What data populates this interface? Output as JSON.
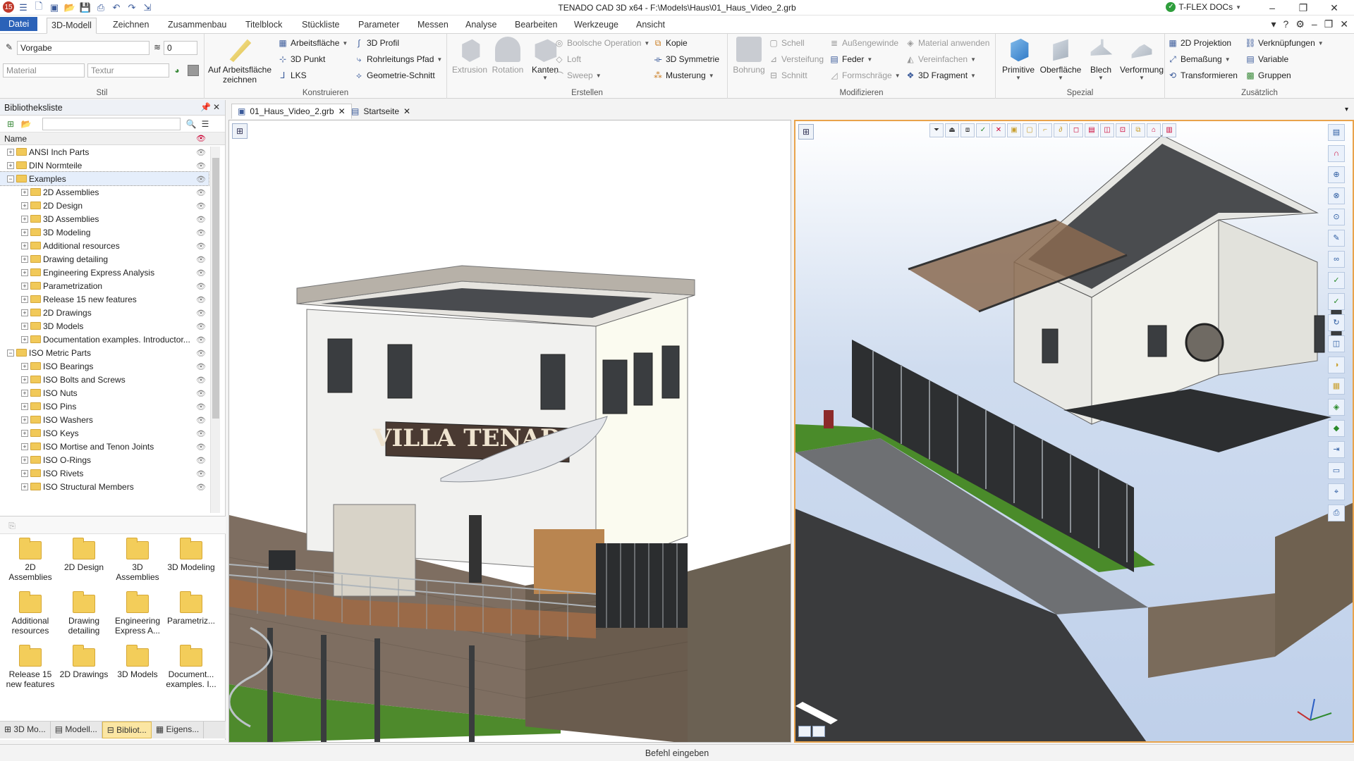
{
  "window": {
    "title": "TENADO CAD 3D x64 - F:\\Models\\Haus\\01_Haus_Video_2.grb",
    "account": "T-FLEX DOCs"
  },
  "menu": {
    "tabs": [
      "Datei",
      "3D-Modell",
      "Zeichnen",
      "Zusammenbau",
      "Titelblock",
      "Stückliste",
      "Parameter",
      "Messen",
      "Analyse",
      "Bearbeiten",
      "Werkzeuge",
      "Ansicht"
    ]
  },
  "ribbon": {
    "stil": {
      "label": "Stil",
      "style_value": "Vorgabe",
      "layer_value": "0",
      "material_placeholder": "Material",
      "texture_placeholder": "Textur"
    },
    "konstruieren": {
      "label": "Konstruieren",
      "big": "Auf Arbeitsfläche zeichnen",
      "items": [
        "Arbeitsfläche",
        "3D Punkt",
        "LKS",
        "3D Profil",
        "Rohrleitungs Pfad",
        "Geometrie-Schnitt"
      ]
    },
    "erstellen": {
      "label": "Erstellen",
      "big": [
        "Extrusion",
        "Rotation",
        "Kanten"
      ],
      "items": [
        "Boolsche Operation",
        "Loft",
        "Sweep",
        "Kopie",
        "3D Symmetrie",
        "Musterung"
      ]
    },
    "modifizieren": {
      "label": "Modifizieren",
      "big": "Bohrung",
      "items": [
        "Schell",
        "Versteifung",
        "Schnitt",
        "Außengewinde",
        "Feder",
        "Formschräge",
        "Material anwenden",
        "Vereinfachen",
        "3D Fragment"
      ]
    },
    "spezial": {
      "label": "Spezial",
      "big": [
        "Primitive",
        "Oberfläche",
        "Blech",
        "Verformung"
      ]
    },
    "zusaetzlich": {
      "label": "Zusätzlich",
      "items": [
        "2D Projektion",
        "Bemaßung",
        "Transformieren",
        "Verknüpfungen",
        "Variable",
        "Gruppen"
      ]
    }
  },
  "library": {
    "title": "Bibliotheksliste",
    "column": "Name",
    "tree": [
      {
        "label": "ANSI Inch Parts",
        "level": 0,
        "expander": "+"
      },
      {
        "label": "DIN Normteile",
        "level": 0,
        "expander": "+"
      },
      {
        "label": "Examples",
        "level": 0,
        "expander": "−",
        "selected": true
      },
      {
        "label": "2D Assemblies",
        "level": 1,
        "expander": "+"
      },
      {
        "label": "2D Design",
        "level": 1,
        "expander": "+"
      },
      {
        "label": "3D Assemblies",
        "level": 1,
        "expander": "+"
      },
      {
        "label": "3D Modeling",
        "level": 1,
        "expander": "+"
      },
      {
        "label": "Additional resources",
        "level": 1,
        "expander": "+"
      },
      {
        "label": "Drawing detailing",
        "level": 1,
        "expander": "+"
      },
      {
        "label": "Engineering Express Analysis",
        "level": 1,
        "expander": "+"
      },
      {
        "label": "Parametrization",
        "level": 1,
        "expander": "+"
      },
      {
        "label": "Release 15 new features",
        "level": 1,
        "expander": "+"
      },
      {
        "label": "2D Drawings",
        "level": 1,
        "expander": "+"
      },
      {
        "label": "3D Models",
        "level": 1,
        "expander": "+"
      },
      {
        "label": "Documentation examples. Introductor...",
        "level": 1,
        "expander": "+"
      },
      {
        "label": "ISO Metric Parts",
        "level": 0,
        "expander": "−"
      },
      {
        "label": "ISO Bearings",
        "level": 1,
        "expander": "+"
      },
      {
        "label": "ISO Bolts and Screws",
        "level": 1,
        "expander": "+"
      },
      {
        "label": "ISO Nuts",
        "level": 1,
        "expander": "+"
      },
      {
        "label": "ISO Pins",
        "level": 1,
        "expander": "+"
      },
      {
        "label": "ISO Washers",
        "level": 1,
        "expander": "+"
      },
      {
        "label": "ISO Keys",
        "level": 1,
        "expander": "+"
      },
      {
        "label": "ISO Mortise and Tenon Joints",
        "level": 1,
        "expander": "+"
      },
      {
        "label": "ISO O-Rings",
        "level": 1,
        "expander": "+"
      },
      {
        "label": "ISO Rivets",
        "level": 1,
        "expander": "+"
      },
      {
        "label": "ISO Structural Members",
        "level": 1,
        "expander": "+"
      }
    ],
    "grid": [
      [
        "2D",
        "Assemblies"
      ],
      [
        "2D Design",
        ""
      ],
      [
        "3D",
        "Assemblies"
      ],
      [
        "3D Modeling",
        ""
      ],
      [
        "Additional",
        "resources"
      ],
      [
        "Drawing",
        "detailing"
      ],
      [
        "Engineering",
        "Express A..."
      ],
      [
        "Parametriz...",
        ""
      ],
      [
        "Release 15",
        "new features"
      ],
      [
        "2D Drawings",
        ""
      ],
      [
        "3D Models",
        ""
      ],
      [
        "Document...",
        "examples. I..."
      ]
    ],
    "bottom_tabs": [
      "3D Mo...",
      "Modell...",
      "Bibliot...",
      "Eigens..."
    ]
  },
  "documents": {
    "tabs": [
      "01_Haus_Video_2.grb",
      "Startseite"
    ]
  },
  "scene": {
    "sign_text": "VILLA  TENADO"
  },
  "status": {
    "command_prompt": "Befehl eingeben"
  }
}
